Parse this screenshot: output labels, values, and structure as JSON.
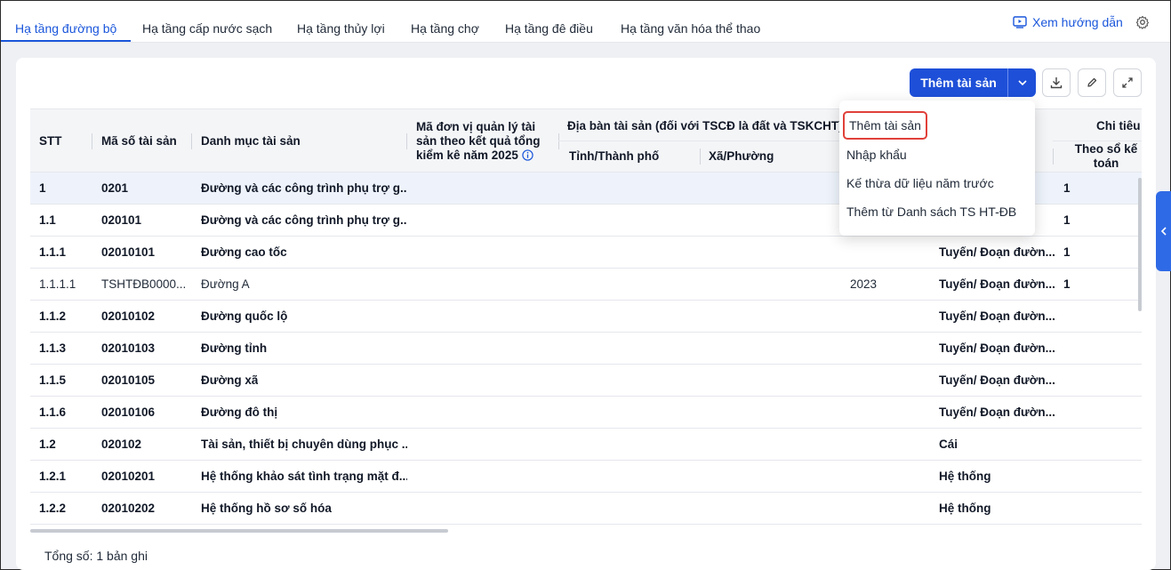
{
  "tabs": [
    {
      "label": "Hạ tầng đường bộ",
      "active": true
    },
    {
      "label": "Hạ tầng cấp nước sạch"
    },
    {
      "label": "Hạ tầng thủy lợi"
    },
    {
      "label": "Hạ tầng chợ"
    },
    {
      "label": "Hạ tầng đê điều"
    },
    {
      "label": "Hạ tầng văn hóa thể thao"
    }
  ],
  "header": {
    "guide_label": "Xem hướng dẫn"
  },
  "toolbar": {
    "add_label": "Thêm tài sản"
  },
  "table": {
    "columns": {
      "stt": "STT",
      "code": "Mã số tài sản",
      "category": "Danh mục tài sản",
      "unit_code": "Mã đơn vị quản lý tài sản theo kết quả tổng kiểm kê năm 2025",
      "location_group": "Địa bàn tài sản (đối với TSCĐ là đất và TSKCHT)",
      "province": "Tỉnh/Thành phố",
      "ward": "Xã/Phường",
      "indicator_group": "Chi tiêu",
      "accounting": "Theo sổ kế toán"
    },
    "rows": [
      {
        "stt": "1",
        "code": "0201",
        "name": "Đường và các công trình phụ trợ g...",
        "year": "",
        "unit": "",
        "qty": "1",
        "bold": true
      },
      {
        "stt": "1.1",
        "code": "020101",
        "name": "Đường và các công trình phụ trợ g...",
        "year": "",
        "unit": "",
        "qty": "1",
        "bold": true
      },
      {
        "stt": "1.1.1",
        "code": "02010101",
        "name": "Đường cao tốc",
        "year": "",
        "unit": "Tuyến/ Đoạn đườn...",
        "qty": "1",
        "bold": true
      },
      {
        "stt": "1.1.1.1",
        "code": "TSHTĐB0000...",
        "name": "Đường A",
        "year": "2023",
        "unit": "Tuyến/ Đoạn đườn...",
        "qty": "1",
        "bold": false
      },
      {
        "stt": "1.1.2",
        "code": "02010102",
        "name": "Đường quốc lộ",
        "year": "",
        "unit": "Tuyến/ Đoạn đườn...",
        "qty": "",
        "bold": true
      },
      {
        "stt": "1.1.3",
        "code": "02010103",
        "name": "Đường tỉnh",
        "year": "",
        "unit": "Tuyến/ Đoạn đườn...",
        "qty": "",
        "bold": true
      },
      {
        "stt": "1.1.5",
        "code": "02010105",
        "name": "Đường xã",
        "year": "",
        "unit": "Tuyến/ Đoạn đườn...",
        "qty": "",
        "bold": true
      },
      {
        "stt": "1.1.6",
        "code": "02010106",
        "name": "Đường đô thị",
        "year": "",
        "unit": "Tuyến/ Đoạn đườn...",
        "qty": "",
        "bold": true
      },
      {
        "stt": "1.2",
        "code": "020102",
        "name": "Tài sản, thiết bị chuyên dùng phục ...",
        "year": "",
        "unit": "Cái",
        "qty": "",
        "bold": true
      },
      {
        "stt": "1.2.1",
        "code": "02010201",
        "name": "Hệ thống khảo sát tình trạng mặt đ...",
        "year": "",
        "unit": "Hệ thống",
        "qty": "",
        "bold": true
      },
      {
        "stt": "1.2.2",
        "code": "02010202",
        "name": "Hệ thống hồ sơ số hóa",
        "year": "",
        "unit": "Hệ thống",
        "qty": "",
        "bold": true
      }
    ]
  },
  "footer": {
    "total_label": "Tổng số:",
    "total_value": "1 bản ghi"
  },
  "dropdown": {
    "items": [
      "Thêm tài sản",
      "Nhập khẩu",
      "Kế thừa dữ liệu năm trước",
      "Thêm từ Danh sách TS HT-ĐB"
    ]
  },
  "colors": {
    "accent": "#1e4fd8",
    "highlight": "#e0403a"
  }
}
